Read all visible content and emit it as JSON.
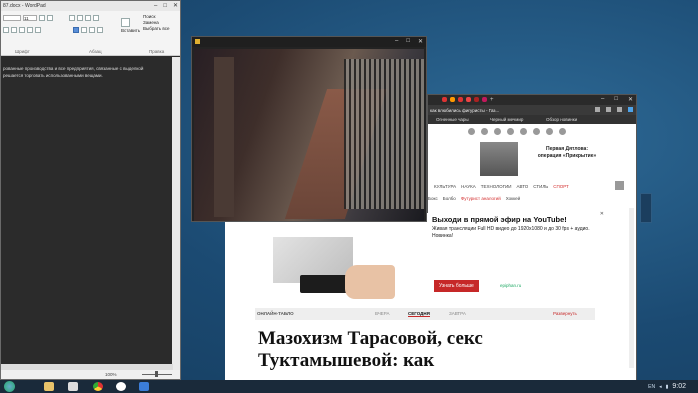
{
  "wordpad": {
    "title": "87.docx - WordPad",
    "font_size": "11",
    "group_font": "Шрифт",
    "group_paragraph": "Абзац",
    "group_edit": "Правка",
    "paste": "Вставить",
    "find": "Поиск",
    "replace": "Замена",
    "select_all": "Выбрать все",
    "doc_text_1": "рованные производства и все предприятия, связанные с выделкой",
    "doc_text_2": "решается торговать использованными вещами.",
    "zoom": "100%"
  },
  "browser": {
    "tab_title": "как влюбились фигуристы - Газ...",
    "bookmark_1": "Огненные чары",
    "bookmark_2": "Черный мечмир",
    "bookmark_3": "Обзор новинки",
    "news_title_1": "Первая Дятлова:",
    "news_title_2": "операция «Прикрытие»",
    "nav": [
      "КУЛЬТУРА",
      "НАУКА",
      "ТЕХНОЛОГИИ",
      "АВТО",
      "СТИЛЬ",
      "СПОРТ"
    ],
    "subnav": [
      "Бокс",
      "Болбо",
      "Футурист аналогий",
      "Хоккей"
    ],
    "promo_title": "Выходи в прямой эфир на YouTube!",
    "promo_text": "Живая трансляции Full HD видео до 1920х1080 и до 30 fps + аудио. Новинка!",
    "promo_button": "Узнать больше",
    "promo_brand": "epiphan.ru",
    "tablo_label": "ОНЛАЙН-ТАБЛО",
    "day_yesterday": "ВЧЕРА",
    "day_today": "СЕГОДНЯ",
    "day_tomorrow": "ЗАВТРА",
    "expand": "Развернуть",
    "headline": "Мазохизм Тарасовой, секс Туктамышевой: как"
  },
  "taskbar": {
    "clock": "9:02",
    "lang": "EN"
  },
  "colors": {
    "desktop": "#1c4f78",
    "accent_red": "#c62828"
  }
}
